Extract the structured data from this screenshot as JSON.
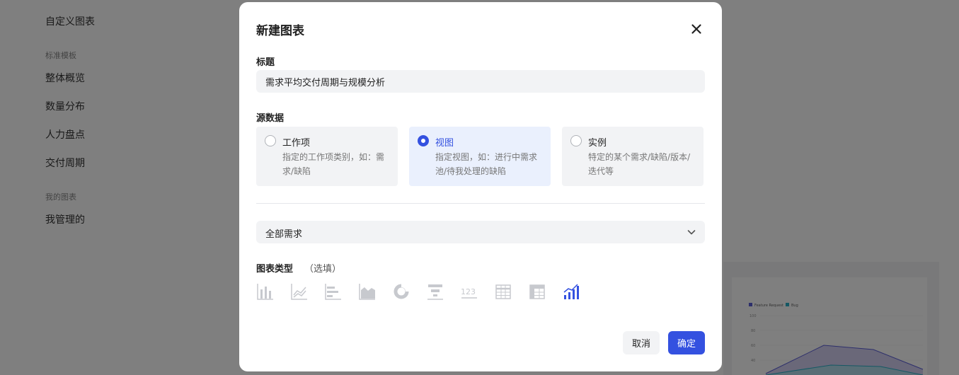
{
  "background": {
    "sidebar": {
      "custom_charts": "自定义图表",
      "standard_templates": "标准模板",
      "items": [
        "整体概览",
        "数量分布",
        "人力盘点",
        "交付周期"
      ],
      "my_charts": "我的图表",
      "my_managed": "我管理的"
    },
    "chart_legend": [
      "Feature Request",
      "Bug"
    ],
    "chart_ticks": [
      "100",
      "80",
      "60",
      "40",
      "20"
    ]
  },
  "modal": {
    "title": "新建图表",
    "title_label": "标题",
    "title_value": "需求平均交付周期与规模分析",
    "source_label": "源数据",
    "sources": [
      {
        "title": "工作项",
        "desc": "指定的工作项类别，如：需求/缺陷",
        "selected": false
      },
      {
        "title": "视图",
        "desc": "指定视图，如：进行中需求池/待我处理的缺陷",
        "selected": true
      },
      {
        "title": "实例",
        "desc": "特定的某个需求/缺陷/版本/迭代等",
        "selected": false
      }
    ],
    "select_value": "全部需求",
    "chart_type_label": "图表类型",
    "chart_type_optional": "（选填）",
    "chart_types": [
      "bar-chart-icon",
      "line-chart-icon",
      "horizontal-bar-icon",
      "area-chart-icon",
      "donut-chart-icon",
      "funnel-chart-icon",
      "number-card-icon",
      "table-icon",
      "pivot-table-icon",
      "combo-chart-icon"
    ],
    "cancel_label": "取消",
    "ok_label": "确定",
    "accent_color": "#3451e0"
  }
}
